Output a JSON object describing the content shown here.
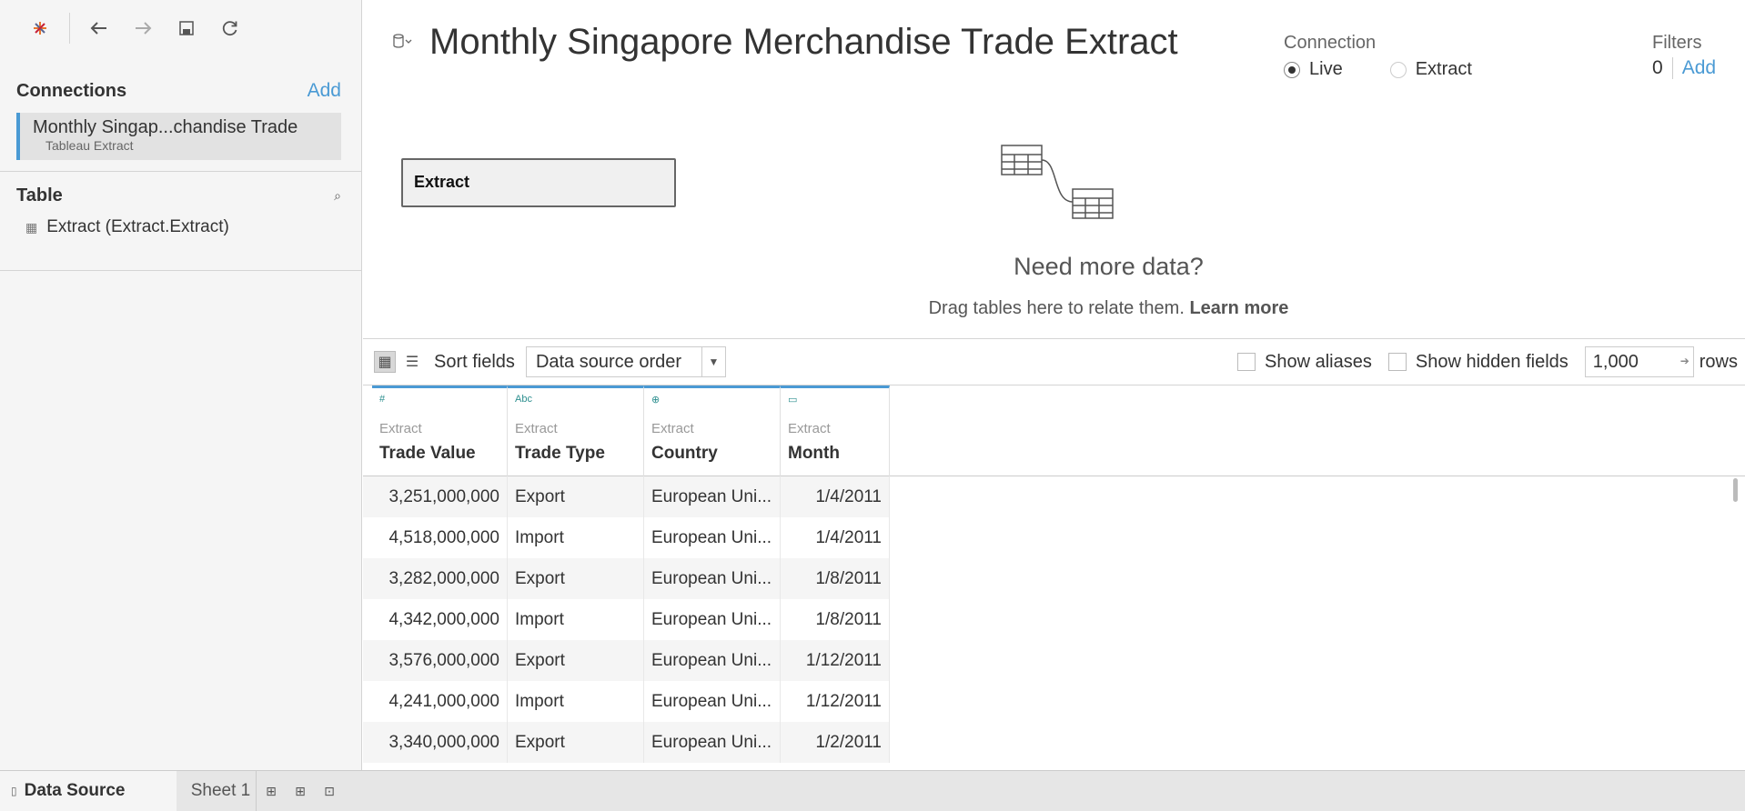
{
  "toolbar": {
    "icons": [
      "tableau-logo-icon",
      "back-icon",
      "forward-icon",
      "save-icon",
      "refresh-icon"
    ]
  },
  "sidebar": {
    "connections_title": "Connections",
    "connections_add": "Add",
    "connection": {
      "name": "Monthly Singap...chandise Trade",
      "type": "Tableau Extract"
    },
    "table_title": "Table",
    "tables": [
      {
        "label": "Extract (Extract.Extract)"
      }
    ]
  },
  "header": {
    "title": "Monthly Singapore Merchandise Trade Extract",
    "connection_label": "Connection",
    "connection_options": [
      "Live",
      "Extract"
    ],
    "connection_selected": "Live",
    "filters_label": "Filters",
    "filters_count": "0",
    "filters_add": "Add"
  },
  "canvas": {
    "table_box": "Extract",
    "need_more": "Need more data?",
    "drag_text": "Drag tables here to relate them.",
    "learn_more": "Learn more"
  },
  "grid_toolbar": {
    "sort_label": "Sort fields",
    "sort_value": "Data source order",
    "show_aliases": "Show aliases",
    "show_hidden": "Show hidden fields",
    "rows_value": "1,000",
    "rows_label": "rows"
  },
  "grid": {
    "columns": [
      {
        "type_icon": "#",
        "source": "Extract",
        "name": "Trade Value"
      },
      {
        "type_icon": "Abc",
        "source": "Extract",
        "name": "Trade Type"
      },
      {
        "type_icon": "⊕",
        "source": "Extract",
        "name": "Country"
      },
      {
        "type_icon": "▭",
        "source": "Extract",
        "name": "Month"
      }
    ],
    "rows": [
      [
        "3,251,000,000",
        "Export",
        "European Uni...",
        "1/4/2011"
      ],
      [
        "4,518,000,000",
        "Import",
        "European Uni...",
        "1/4/2011"
      ],
      [
        "3,282,000,000",
        "Export",
        "European Uni...",
        "1/8/2011"
      ],
      [
        "4,342,000,000",
        "Import",
        "European Uni...",
        "1/8/2011"
      ],
      [
        "3,576,000,000",
        "Export",
        "European Uni...",
        "1/12/2011"
      ],
      [
        "4,241,000,000",
        "Import",
        "European Uni...",
        "1/12/2011"
      ],
      [
        "3,340,000,000",
        "Export",
        "European Uni...",
        "1/2/2011"
      ]
    ]
  },
  "tabs": {
    "data_source": "Data Source",
    "sheet": "Sheet 1"
  },
  "colors": {
    "accent": "#4a9ad4",
    "sidebar_bg": "#f5f5f5"
  }
}
